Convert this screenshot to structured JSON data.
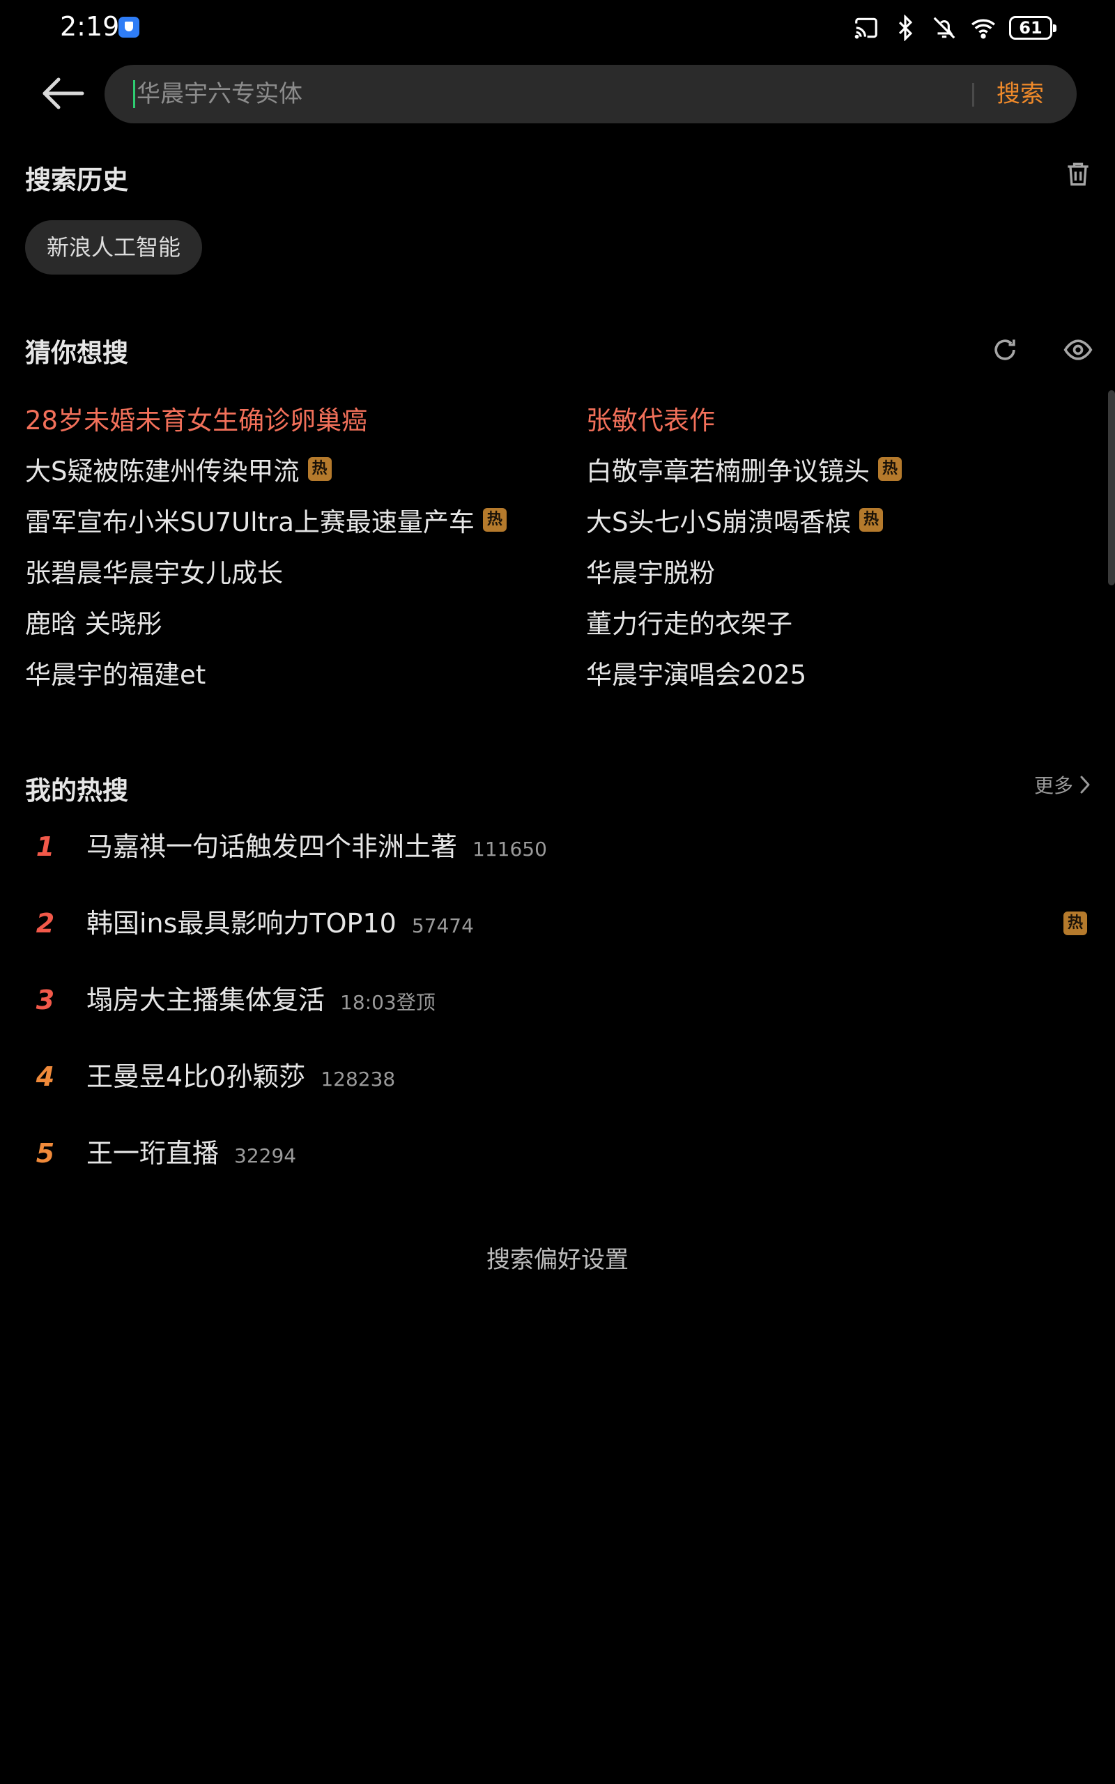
{
  "status_bar": {
    "time": "2:19",
    "battery": "61"
  },
  "search": {
    "placeholder": "华晨宇六专实体",
    "button_label": "搜索"
  },
  "history": {
    "title": "搜索历史",
    "items": [
      "新浪人工智能"
    ]
  },
  "guess": {
    "title": "猜你想搜",
    "hot_badge": "热",
    "left": [
      {
        "text": "28岁未婚未育女生确诊卵巢癌",
        "highlight": true,
        "hot": false
      },
      {
        "text": "大S疑被陈建州传染甲流",
        "highlight": false,
        "hot": true
      },
      {
        "text": "雷军宣布小米SU7Ultra上赛最速量产车",
        "highlight": false,
        "hot": true
      },
      {
        "text": "张碧晨华晨宇女儿成长",
        "highlight": false,
        "hot": false
      },
      {
        "text": "鹿晗 关晓彤",
        "highlight": false,
        "hot": false
      },
      {
        "text": "华晨宇的福建et",
        "highlight": false,
        "hot": false
      }
    ],
    "right": [
      {
        "text": "张敏代表作",
        "highlight": true,
        "hot": false
      },
      {
        "text": "白敬亭章若楠删争议镜头",
        "highlight": false,
        "hot": true
      },
      {
        "text": "大S头七小S崩溃喝香槟",
        "highlight": false,
        "hot": true
      },
      {
        "text": "华晨宇脱粉",
        "highlight": false,
        "hot": false
      },
      {
        "text": "董力行走的衣架子",
        "highlight": false,
        "hot": false
      },
      {
        "text": "华晨宇演唱会2025",
        "highlight": false,
        "hot": false
      }
    ]
  },
  "my_hot": {
    "title": "我的热搜",
    "more_label": "更多",
    "items": [
      {
        "rank": "1",
        "title": "马嘉祺一句话触发四个非洲土著",
        "meta": "111650",
        "hot": false
      },
      {
        "rank": "2",
        "title": "韩国ins最具影响力TOP10",
        "meta": "57474",
        "hot": true
      },
      {
        "rank": "3",
        "title": "塌房大主播集体复活",
        "meta": "18:03登顶",
        "hot": false
      },
      {
        "rank": "4",
        "title": "王曼昱4比0孙颖莎",
        "meta": "128238",
        "hot": false
      },
      {
        "rank": "5",
        "title": "王一珩直播",
        "meta": "32294",
        "hot": false
      }
    ]
  },
  "footer": {
    "preference_label": "搜索偏好设置"
  },
  "colors": {
    "background": "#000000",
    "accent": "#f08a2a",
    "highlight_text": "#f2705a",
    "hot_badge": "#b57a2c"
  }
}
